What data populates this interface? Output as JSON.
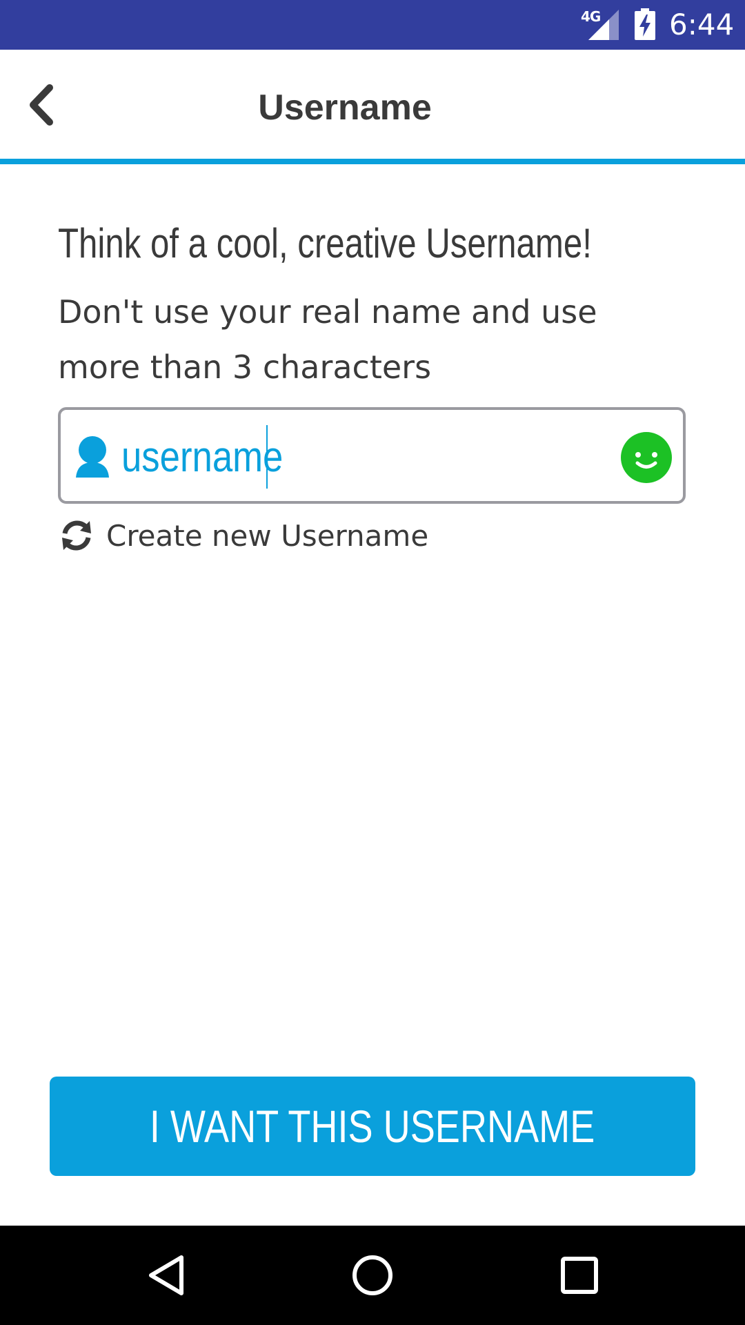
{
  "status_bar": {
    "network": "4G",
    "time": "6:44",
    "icons": [
      "signal-icon",
      "battery-charging-icon"
    ]
  },
  "app_bar": {
    "title": "Username",
    "back_icon": "chevron-left-icon"
  },
  "content": {
    "headline": "Think of a cool, creative Username!",
    "subtext": "Don't use your real name and use more than 3 characters",
    "username_field": {
      "value": "username",
      "leading_icon": "user-icon",
      "trailing_icon": "smiley-icon"
    },
    "regenerate": {
      "label": "Create new Username",
      "icon": "refresh-icon"
    }
  },
  "cta": {
    "label": "I WANT THIS USERNAME"
  },
  "nav_bar": {
    "icons": [
      "back-triangle-icon",
      "home-circle-icon",
      "recents-square-icon"
    ]
  },
  "colors": {
    "status_bar": "#323e9e",
    "accent": "#0aa0dc",
    "text": "#3a3a3a",
    "smiley": "#1cc125",
    "input_border": "#9a9aa0"
  }
}
